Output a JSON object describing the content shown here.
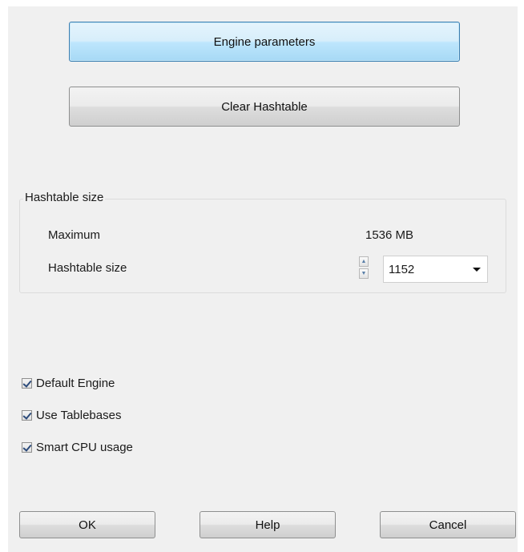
{
  "buttons": {
    "engine_parameters": "Engine parameters",
    "clear_hashtable": "Clear Hashtable"
  },
  "hashtable_group": {
    "title": "Hashtable size",
    "maximum_label": "Maximum",
    "maximum_value": "1536 MB",
    "size_label": "Hashtable size",
    "size_value": "1152"
  },
  "options": {
    "default_engine": {
      "label": "Default Engine",
      "checked": true
    },
    "use_tablebases": {
      "label": "Use Tablebases",
      "checked": true
    },
    "smart_cpu": {
      "label": "Smart CPU usage",
      "checked": true
    }
  },
  "footer": {
    "ok": "OK",
    "help": "Help",
    "cancel": "Cancel"
  },
  "colors": {
    "dialog_bg": "#f0f0f0",
    "focus_border": "#3c7fb1",
    "focus_fill": "#bee6fd"
  }
}
